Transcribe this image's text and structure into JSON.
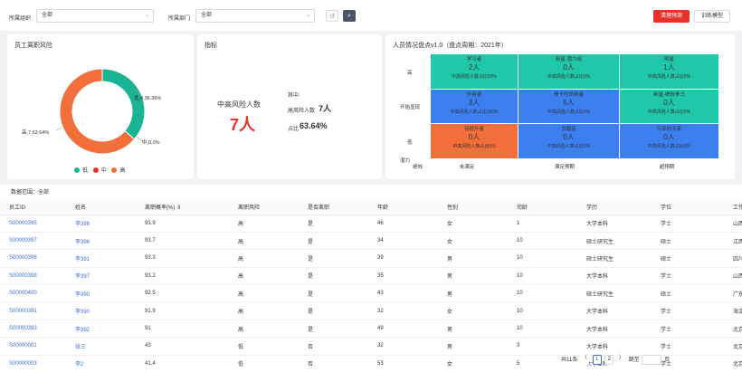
{
  "filters": {
    "org_label": "所属组织",
    "org_value": "全部",
    "dept_label": "所属部门",
    "dept_value": "全部",
    "reset_icon": "reset-icon",
    "search_icon": "search-icon"
  },
  "actions": {
    "primary": "清理预测",
    "secondary": "训练模型"
  },
  "donut": {
    "title": "员工离职风险",
    "label_low": "低,4,36.36%",
    "label_mid": "中,0,0%",
    "label_high": "高,7,63.64%",
    "legend": [
      "低",
      "中",
      "高"
    ],
    "colors": {
      "low": "#1ab394",
      "mid": "#e8312a",
      "high": "#f26e3a"
    }
  },
  "chart_data": {
    "type": "pie",
    "title": "员工离职风险",
    "categories": [
      "低",
      "中",
      "高"
    ],
    "values": [
      4,
      0,
      7
    ],
    "percents": [
      36.36,
      0,
      63.64
    ],
    "legend_position": "bottom"
  },
  "metric": {
    "title": "指标",
    "main_label": "中高风险人数",
    "main_value": "7人",
    "sub_header": "其中:",
    "sub_label": "高风险人数",
    "sub_value": "7人",
    "ratio_label": "占比",
    "ratio_value": "63.64%"
  },
  "grid": {
    "title": "人员情况盘点v1.0（盘点周期：2021年）",
    "y_labels": [
      "高",
      "开始显现",
      "低"
    ],
    "y_axis_name": "潜力",
    "x_axis_name": "绩效",
    "x_labels": [
      "未满足",
      "满足预期",
      "超预期"
    ],
    "cells": [
      {
        "name": "学习者",
        "count": "2人",
        "ratio": "中高风险人数占比50%",
        "color": "#1ec8a8"
      },
      {
        "name": "新星-潜力组",
        "count": "0人",
        "ratio": "中高风险人数占比0%",
        "color": "#1ec8a8"
      },
      {
        "name": "明星",
        "count": "1人",
        "ratio": "中高风险人数占比0%",
        "color": "#1ec8a8"
      },
      {
        "name": "外容者",
        "count": "3人",
        "ratio": "中高风险人数占比100%",
        "color": "#3b7ff0"
      },
      {
        "name": "骨干的员新者",
        "count": "5人",
        "ratio": "中高风险人数占比0%",
        "color": "#3b7ff0"
      },
      {
        "name": "新星-绩效骨马",
        "count": "0人",
        "ratio": "中高风险人数占比0%",
        "color": "#1ec8a8"
      },
      {
        "name": "待提升者",
        "count": "0人",
        "ratio": "中高风险人数占比0%",
        "color": "#f26e3a"
      },
      {
        "name": "贡献者",
        "count": "0人",
        "ratio": "中高风险人数占比0%",
        "color": "#3b7ff0"
      },
      {
        "name": "可靠的专家",
        "count": "0人",
        "ratio": "中高风险人数占比0%",
        "color": "#3b7ff0"
      }
    ]
  },
  "table": {
    "filter_note": "数据范围：全部",
    "headers": [
      "员工ID",
      "姓名",
      "离职概率(%) ⇕",
      "离职风险",
      "是否离职",
      "年龄",
      "性别",
      "司龄",
      "学历",
      "学位",
      "工作"
    ],
    "rows": [
      [
        "S00000395",
        "李396",
        "93.9",
        "高",
        "是",
        "46",
        "女",
        "1",
        "大学本科",
        "学士",
        "山西"
      ],
      [
        "S00000397",
        "李396",
        "93.7",
        "高",
        "是",
        "34",
        "女",
        "10",
        "硕士研究生",
        "硕士",
        "江西"
      ],
      [
        "S00000396",
        "李391",
        "93.3",
        "高",
        "是",
        "39",
        "男",
        "10",
        "硕士研究生",
        "硕士",
        "四川"
      ],
      [
        "S00000398",
        "李397",
        "93.2",
        "高",
        "是",
        "35",
        "男",
        "10",
        "大学本科",
        "学士",
        "山西"
      ],
      [
        "S00000400",
        "李390",
        "92.5",
        "高",
        "是",
        "43",
        "男",
        "10",
        "硕士研究生",
        "硕士",
        "广东"
      ],
      [
        "S00000391",
        "李390",
        "91.9",
        "高",
        "是",
        "32",
        "女",
        "10",
        "大学本科",
        "学士",
        "海淀"
      ],
      [
        "S00000393",
        "李392",
        "91",
        "高",
        "是",
        "49",
        "男",
        "10",
        "大学本科",
        "学士",
        "北京"
      ],
      [
        "S00000001",
        "张三",
        "43",
        "低",
        "否",
        "32",
        "男",
        "3",
        "大学本科",
        "学士",
        "北京"
      ],
      [
        "S00000003",
        "李2",
        "41.4",
        "低",
        "否",
        "53",
        "女",
        "5",
        "大学本科",
        "学士",
        "北京"
      ]
    ]
  },
  "pager": {
    "total": "共11条",
    "prev": "〈",
    "page1": "1",
    "page2": "2",
    "next": "〉",
    "jump": "跳至",
    "page_unit": "页"
  }
}
